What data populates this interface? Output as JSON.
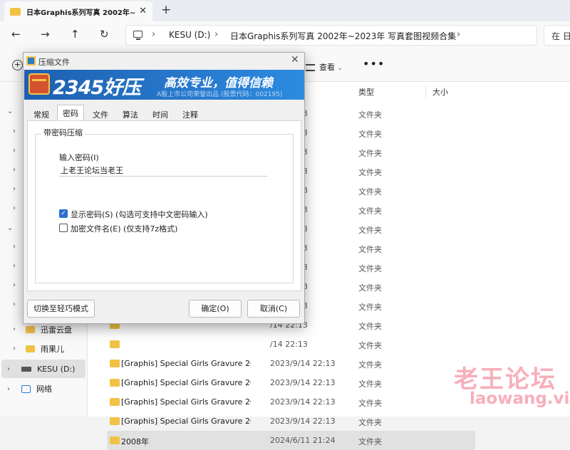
{
  "tab": {
    "title": "日本Graphis系列写真 2002年~",
    "close": "✕",
    "new": "+"
  },
  "nav": {
    "back": "←",
    "forward": "→",
    "up": "↑",
    "refresh": "↻",
    "breadcrumbs": [
      "KESU (D:)",
      "日本Graphis系列写真 2002年~2023年 写真套图视频合集"
    ],
    "sep": "›",
    "search_placeholder": "在 日"
  },
  "cmd": {
    "view": "查看",
    "view_caret": "⌄",
    "more": "•••",
    "new": "+"
  },
  "columns": {
    "type": "类型",
    "size": "大小"
  },
  "files": [
    {
      "name": "",
      "date": "/14 22:13",
      "type": "文件夹"
    },
    {
      "name": "",
      "date": "/14 22:13",
      "type": "文件夹"
    },
    {
      "name": "",
      "date": "/14 22:13",
      "type": "文件夹"
    },
    {
      "name": "",
      "date": "/14 22:13",
      "type": "文件夹"
    },
    {
      "name": "",
      "date": "/14 22:13",
      "type": "文件夹"
    },
    {
      "name": "",
      "date": "/14 22:13",
      "type": "文件夹"
    },
    {
      "name": "",
      "date": "/14 22:13",
      "type": "文件夹"
    },
    {
      "name": "",
      "date": "/14 22:13",
      "type": "文件夹"
    },
    {
      "name": "",
      "date": "/14 22:13",
      "type": "文件夹"
    },
    {
      "name": "",
      "date": "/14 22:13",
      "type": "文件夹"
    },
    {
      "name": "",
      "date": "/14 22:13",
      "type": "文件夹"
    },
    {
      "name": "",
      "date": "/14 22:13",
      "type": "文件夹"
    },
    {
      "name": "",
      "date": "/14 22:13",
      "type": "文件夹"
    },
    {
      "name": "[Graphis] Special Girls Gravure 2012-...",
      "date": "2023/9/14 22:13",
      "type": "文件夹"
    },
    {
      "name": "[Graphis] Special Girls Gravure 2012-...",
      "date": "2023/9/14 22:13",
      "type": "文件夹"
    },
    {
      "name": "[Graphis] Special Girls Gravure 2012-...",
      "date": "2023/9/14 22:13",
      "type": "文件夹"
    },
    {
      "name": "[Graphis] Special Girls Gravure 2012-...",
      "date": "2023/9/14 22:13",
      "type": "文件夹"
    },
    {
      "name": "2008年",
      "date": "2024/6/11 21:24",
      "type": "文件夹"
    }
  ],
  "sidebar": {
    "items": [
      {
        "label": "迅雷云盘"
      },
      {
        "label": "雨果儿"
      },
      {
        "label": "KESU (D:)"
      },
      {
        "label": "网络"
      }
    ]
  },
  "dialog": {
    "title": "压缩文件",
    "close": "✕",
    "banner_brand": "2345好压",
    "banner_slogan": "高效专业，值得信赖",
    "banner_sub": "A股上市公司荣誉出品 (股票代码：002195)",
    "tabs": [
      "常规",
      "密码",
      "文件",
      "算法",
      "时间",
      "注释"
    ],
    "group_label": "带密码压缩",
    "pwd_label": "输入密码(I)",
    "pwd_value": "上老王论坛当老王",
    "show_pwd_label": "显示密码(S) (勾选可支持中文密码输入)",
    "show_pwd_check": "✓",
    "encrypt_label": "加密文件名(E) (仅支持7z格式)",
    "switch_btn": "切换至轻巧模式",
    "ok_btn": "确定(O)",
    "cancel_btn": "取消(C)"
  },
  "watermark": {
    "line1": "老王论坛",
    "line2": "laowang.vip"
  }
}
